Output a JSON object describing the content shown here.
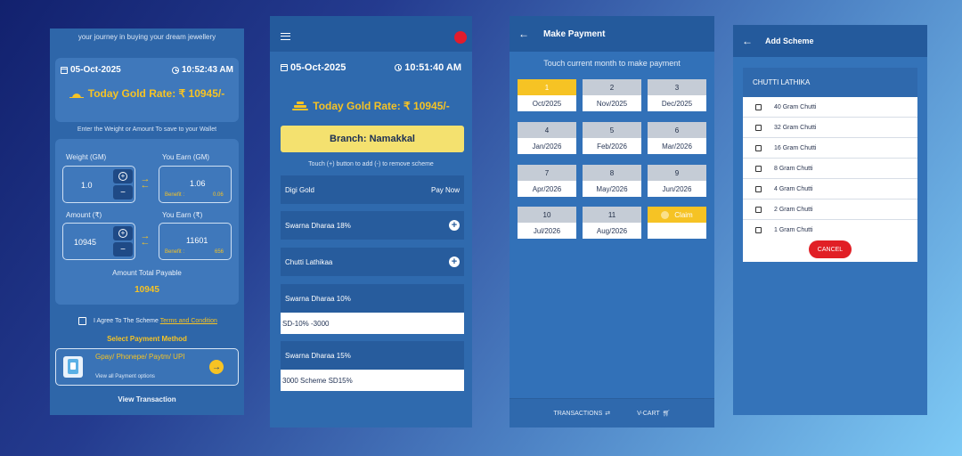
{
  "screen1": {
    "intro": "your journey in buying your dream jewellery",
    "date": "05-Oct-2025",
    "time": "10:52:43 AM",
    "gold_rate": "Today Gold Rate: ₹ 10945/-",
    "hint": "Enter the Weight or Amount To save to your Wallet",
    "weight_label": "Weight (GM)",
    "weight_value": "1.0",
    "earn_gm_label": "You Earn (GM)",
    "earn_gm_value": "1.06",
    "benefit_label": "Benefit :",
    "benefit_gm_value": "0.06",
    "amount_label": "Amount (₹)",
    "amount_value": "10945",
    "earn_rs_label": "You Earn (₹)",
    "earn_rs_value": "11601",
    "benefit_rs_value": "656",
    "total_label": "Amount Total Payable",
    "total_value": "10945",
    "terms_prefix": "I Agree To The Scheme",
    "terms_link": "Terms and Condition",
    "payment_method_label": "Select Payment Method",
    "payment_title": "Gpay/ Phonepe/ Paytm/ UPI",
    "payment_sub": "View all Payment options",
    "view_transaction": "View Transaction"
  },
  "screen2": {
    "date": "05-Oct-2025",
    "time": "10:51:40 AM",
    "gold_rate": "Today Gold Rate: ₹ 10945/-",
    "branch": "Branch: Namakkal",
    "hint": "Touch (+) button to add (-) to remove scheme",
    "digi_gold": "Digi Gold",
    "pay_now": "Pay Now",
    "schemes": [
      {
        "label": "Swarna Dharaa 18%"
      },
      {
        "label": "Chutti Lathikaa"
      }
    ],
    "scheme_10": "Swarna Dharaa 10%",
    "scheme_10_sub": "SD-10% -3000",
    "scheme_15": "Swarna Dharaa 15%",
    "scheme_15_sub": "3000 Scheme SD15%"
  },
  "screen3": {
    "title": "Make Payment",
    "hint": "Touch current month to make payment",
    "months": [
      {
        "num": "1",
        "month": "Oct/2025"
      },
      {
        "num": "2",
        "month": "Nov/2025"
      },
      {
        "num": "3",
        "month": "Dec/2025"
      },
      {
        "num": "4",
        "month": "Jan/2026"
      },
      {
        "num": "5",
        "month": "Feb/2026"
      },
      {
        "num": "6",
        "month": "Mar/2026"
      },
      {
        "num": "7",
        "month": "Apr/2026"
      },
      {
        "num": "8",
        "month": "May/2026"
      },
      {
        "num": "9",
        "month": "Jun/2026"
      },
      {
        "num": "10",
        "month": "Jul/2026"
      },
      {
        "num": "11",
        "month": "Aug/2026"
      }
    ],
    "claim_label": "Claim",
    "footer_transactions": "TRANSACTIONS",
    "footer_vcart": "V-CART"
  },
  "screen4": {
    "title": "Add Scheme",
    "panel_title": "CHUTTI LATHIKA",
    "options": [
      {
        "label": "40 Gram Chutti"
      },
      {
        "label": "32 Gram Chutti"
      },
      {
        "label": "16 Gram Chutti"
      },
      {
        "label": "8 Gram Chutti"
      },
      {
        "label": "4 Gram Chutti"
      },
      {
        "label": "2 Gram Chutti"
      },
      {
        "label": "1 Gram Chutti"
      }
    ],
    "cancel": "CANCEL"
  },
  "colors": {
    "accent_gold": "#f6c324",
    "primary_blue": "#2e66a9",
    "cancel_red": "#e11f26",
    "record_red": "#e21c2c"
  }
}
